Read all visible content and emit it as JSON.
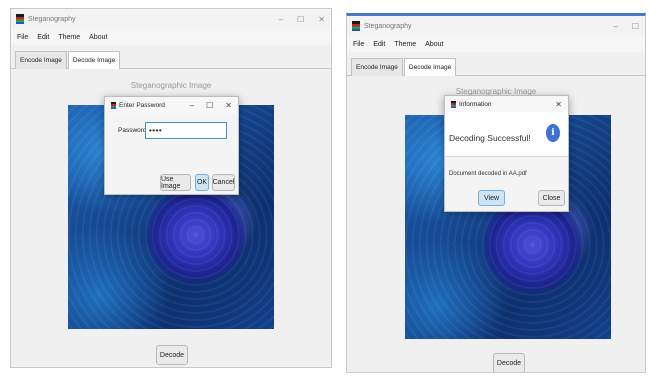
{
  "left_window": {
    "title": "Steganography",
    "controls": {
      "minimize": "–",
      "maximize": "☐",
      "close": "✕"
    },
    "menu": [
      "File",
      "Edit",
      "Theme",
      "About"
    ],
    "tabs": [
      {
        "label": "Encode Image",
        "active": false
      },
      {
        "label": "Decode Image",
        "active": true
      }
    ],
    "section_title": "Steganographic Image",
    "decode_label": "Decode",
    "password_dialog": {
      "title": "Enter Password",
      "controls": {
        "minimize": "–",
        "maximize": "☐",
        "close": "✕"
      },
      "password_label": "Password:",
      "password_value": "••••",
      "use_image_label": "Use Image",
      "ok_label": "OK",
      "cancel_label": "Cancel"
    }
  },
  "right_window": {
    "title": "Steganography",
    "controls": {
      "minimize": "–",
      "maximize": "☐"
    },
    "menu": [
      "File",
      "Edit",
      "Theme",
      "About"
    ],
    "tabs": [
      {
        "label": "Encode Image",
        "active": false
      },
      {
        "label": "Decode Image",
        "active": true
      }
    ],
    "section_title": "Steganographic Image",
    "decode_label": "Decode",
    "info_dialog": {
      "title": "Information",
      "close": "✕",
      "heading": "Decoding Successful!",
      "badge": "i",
      "message": "Document decoded in AA.pdf",
      "view_label": "View",
      "close_label": "Close"
    }
  },
  "icons": [
    "app-icon",
    "info-icon",
    "rose-image"
  ],
  "colors": {
    "accent": "#3b8fd3",
    "info_badge": "#3f72d2",
    "title_bar_accent": "#4a78c9"
  }
}
